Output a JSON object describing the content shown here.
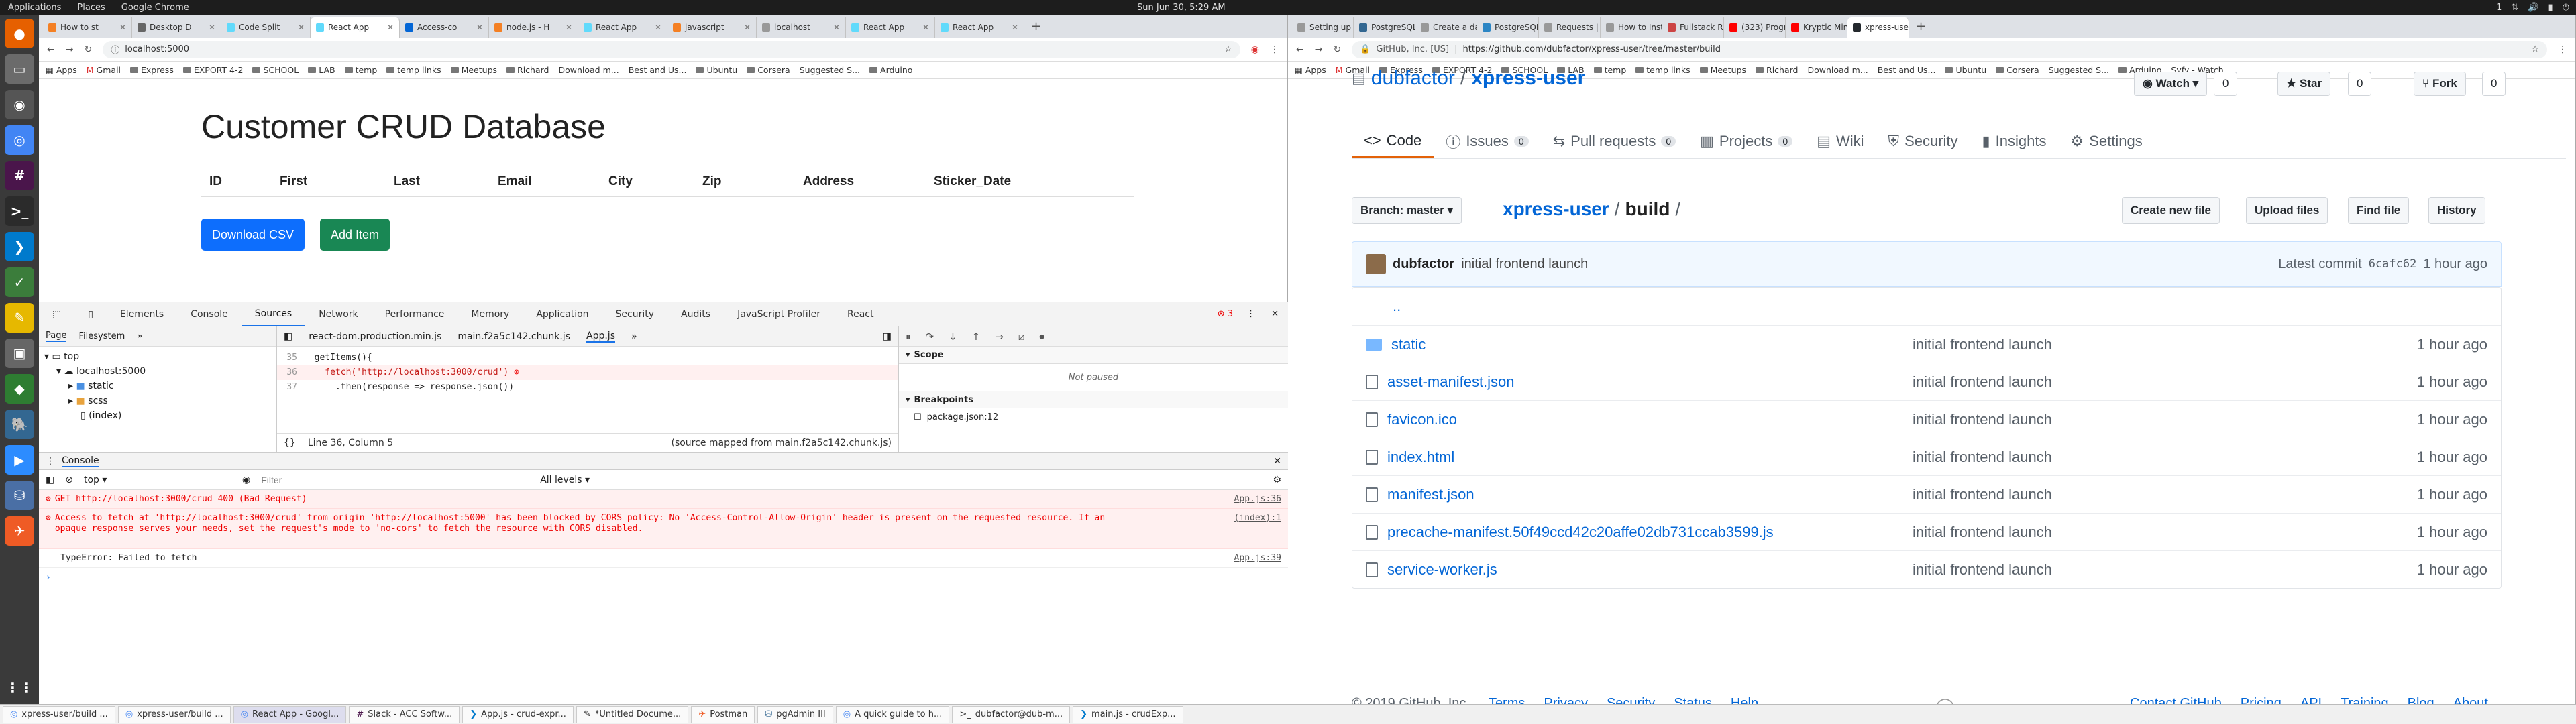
{
  "topbar": {
    "applications": "Applications",
    "places": "Places",
    "app": "Google Chrome",
    "clock": "Sun Jun 30,  5:29 AM",
    "ind": "1"
  },
  "left_chrome": {
    "tabs": [
      "How to st",
      "Desktop D",
      "Code Split",
      "React App",
      "Access-co",
      "node.js - H",
      "React App",
      "javascript",
      "localhost",
      "React App",
      "React App"
    ],
    "active_tab": 3,
    "url": "localhost:5000",
    "bookmarks": [
      "Apps",
      "Gmail",
      "Express",
      "EXPORT 4-2",
      "SCHOOL",
      "LAB",
      "temp",
      "temp links",
      "Meetups",
      "Richard",
      "Download m...",
      "Best and Us...",
      "Ubuntu",
      "Corsera",
      "Suggested S...",
      "Arduino"
    ]
  },
  "app": {
    "title": "Customer CRUD Database",
    "columns": [
      "ID",
      "First",
      "Last",
      "Email",
      "City",
      "Zip",
      "Address",
      "Sticker_Date"
    ],
    "download_csv": "Download CSV",
    "add_item": "Add Item"
  },
  "devtools": {
    "tabs": [
      "Elements",
      "Console",
      "Sources",
      "Network",
      "Performance",
      "Memory",
      "Application",
      "Security",
      "Audits",
      "JavaScript Profiler",
      "React"
    ],
    "active_tab": "Sources",
    "error_count": "3",
    "nav_tabs": [
      "Page",
      "Filesystem"
    ],
    "file_tabs": [
      "react-dom.production.min.js",
      "main.f2a5c142.chunk.js",
      "App.js"
    ],
    "tree": [
      "top",
      "localhost:5000",
      "static",
      "scss",
      "(index)"
    ],
    "code": [
      {
        "n": "35",
        "t": "  getItems(){"
      },
      {
        "n": "36",
        "t": "    fetch('http://localhost:3000/crud')"
      },
      {
        "n": "37",
        "t": "      .then(response => response.json())"
      }
    ],
    "status": "Line 36, Column 5",
    "source_mapped": "(source mapped from main.f2a5c142.chunk.js)",
    "scope": "Scope",
    "not_paused": "Not paused",
    "breakpoints": "Breakpoints",
    "breakpoint_file": "package.json:12",
    "console_title": "Console",
    "context": "top",
    "filter_placeholder": "Filter",
    "levels": "All levels",
    "messages": [
      {
        "text": "GET http://localhost:3000/crud 400 (Bad Request)",
        "src": "App.js:36",
        "type": "error"
      },
      {
        "text": "Access to fetch at 'http://localhost:3000/crud' from origin 'http://localhost:5000' has been blocked by CORS policy: No 'Access-Control-Allow-Origin' header is present on the requested resource. If an opaque response serves your needs, set the request's mode to 'no-cors' to fetch the resource with CORS disabled.",
        "src": "(index):1",
        "type": "error"
      },
      {
        "text": "TypeError: Failed to fetch",
        "src": "App.js:39",
        "type": "plain"
      }
    ]
  },
  "right_chrome": {
    "tabs": [
      "Setting up a",
      "PostgreSQL: D",
      "Create a data",
      "PostgreSQL ar",
      "Requests | Po",
      "How to Install",
      "Fullstack Rea",
      "(323) Program",
      "Kryptic Minds",
      "xpress-user/b"
    ],
    "active_tab": 9,
    "url": "https://github.com/dubfactor/xpress-user/tree/master/build",
    "cert": "GitHub, Inc. [US]",
    "bookmarks": [
      "Apps",
      "Gmail",
      "Express",
      "EXPORT 4-2",
      "SCHOOL",
      "LAB",
      "temp",
      "temp links",
      "Meetups",
      "Richard",
      "Download m...",
      "Best and Us...",
      "Ubuntu",
      "Corsera",
      "Suggested S...",
      "Arduino",
      "Syfy - Watch..."
    ]
  },
  "github": {
    "owner": "dubfactor",
    "repo": "xpress-user",
    "watch": "Watch",
    "watch_count": "0",
    "star": "Star",
    "star_count": "0",
    "fork": "Fork",
    "fork_count": "0",
    "nav": [
      {
        "label": "Code",
        "count": ""
      },
      {
        "label": "Issues",
        "count": "0"
      },
      {
        "label": "Pull requests",
        "count": "0"
      },
      {
        "label": "Projects",
        "count": "0"
      },
      {
        "label": "Wiki",
        "count": ""
      },
      {
        "label": "Security",
        "count": ""
      },
      {
        "label": "Insights",
        "count": ""
      },
      {
        "label": "Settings",
        "count": ""
      }
    ],
    "branch": "Branch: master",
    "path_repo": "xpress-user",
    "path_dir": "build",
    "buttons": [
      "Create new file",
      "Upload files",
      "Find file",
      "History"
    ],
    "commit_author": "dubfactor",
    "commit_msg": "initial frontend launch",
    "latest_commit": "Latest commit",
    "commit_sha": "6cafc62",
    "commit_age": "1 hour ago",
    "parent": "..",
    "files": [
      {
        "name": "static",
        "msg": "initial frontend launch",
        "age": "1 hour ago",
        "dir": true
      },
      {
        "name": "asset-manifest.json",
        "msg": "initial frontend launch",
        "age": "1 hour ago",
        "dir": false
      },
      {
        "name": "favicon.ico",
        "msg": "initial frontend launch",
        "age": "1 hour ago",
        "dir": false
      },
      {
        "name": "index.html",
        "msg": "initial frontend launch",
        "age": "1 hour ago",
        "dir": false
      },
      {
        "name": "manifest.json",
        "msg": "initial frontend launch",
        "age": "1 hour ago",
        "dir": false
      },
      {
        "name": "precache-manifest.50f49ccd42c20affe02db731ccab3599.js",
        "msg": "initial frontend launch",
        "age": "1 hour ago",
        "dir": false
      },
      {
        "name": "service-worker.js",
        "msg": "initial frontend launch",
        "age": "1 hour ago",
        "dir": false
      }
    ],
    "footer_left": [
      "© 2019 GitHub, Inc.",
      "Terms",
      "Privacy",
      "Security",
      "Status",
      "Help"
    ],
    "footer_right": [
      "Contact GitHub",
      "Pricing",
      "API",
      "Training",
      "Blog",
      "About"
    ]
  },
  "taskbar": [
    "xpress-user/build ...",
    "xpress-user/build ...",
    "React App - Googl...",
    "Slack - ACC Softw...",
    "App.js - crud-expr...",
    "*Untitled Docume...",
    "Postman",
    "pgAdmin III",
    "A quick guide to h...",
    "dubfactor@dub-m...",
    "main.js - crudExp..."
  ]
}
